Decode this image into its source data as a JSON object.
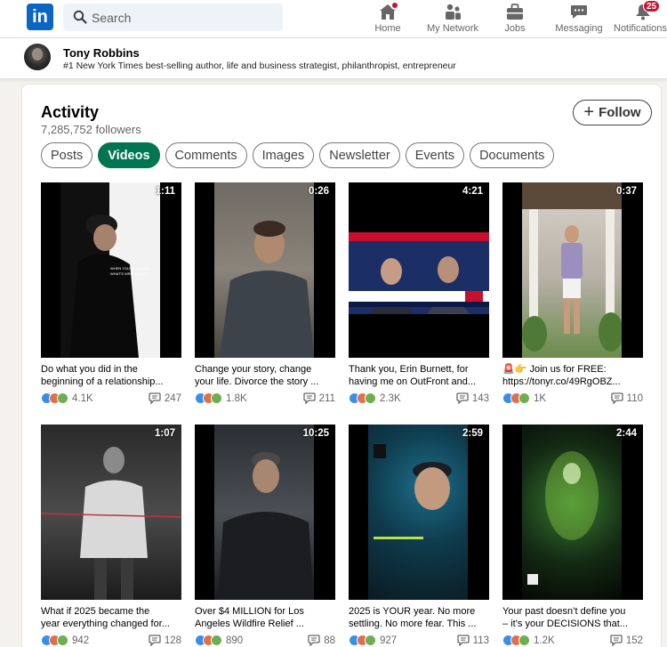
{
  "nav": {
    "logo_text": "in",
    "search_placeholder": "Search",
    "items": [
      {
        "label": "Home",
        "icon": "home-icon"
      },
      {
        "label": "My Network",
        "icon": "network-icon"
      },
      {
        "label": "Jobs",
        "icon": "briefcase-icon"
      },
      {
        "label": "Messaging",
        "icon": "message-icon"
      },
      {
        "label": "Notifications",
        "icon": "bell-icon",
        "badge": "25"
      }
    ]
  },
  "profile": {
    "name": "Tony Robbins",
    "tagline": "#1 New York Times best-selling author, life and business strategist, philanthropist, entrepreneur"
  },
  "activity": {
    "title": "Activity",
    "followers": "7,285,752 followers",
    "follow_label": "Follow",
    "tabs": [
      "Posts",
      "Videos",
      "Comments",
      "Images",
      "Newsletter",
      "Events",
      "Documents"
    ],
    "active_tab": "Videos"
  },
  "videos": [
    {
      "duration": "1:11",
      "caption_line1": "Do what you did in the",
      "caption_line2": "beginning of a relationship...",
      "reactions": "4.1K",
      "comments": "247"
    },
    {
      "duration": "0:26",
      "caption_line1": "Change your story, change",
      "caption_line2": "your life. Divorce the story ...",
      "reactions": "1.8K",
      "comments": "211"
    },
    {
      "duration": "4:21",
      "caption_line1": "Thank you, Erin Burnett, for",
      "caption_line2": "having me on OutFront and...",
      "reactions": "2.3K",
      "comments": "143"
    },
    {
      "duration": "0:37",
      "caption_line1": "Join us for FREE:",
      "caption_line2": "https://tonyr.co/49RgOBZ...",
      "reactions": "1K",
      "comments": "110"
    },
    {
      "duration": "1:07",
      "caption_line1": "What if 2025 became the",
      "caption_line2": "year everything changed for...",
      "reactions": "942",
      "comments": "128"
    },
    {
      "duration": "10:25",
      "caption_line1": "Over $4 MILLION for Los",
      "caption_line2": "Angeles Wildfire Relief ...",
      "reactions": "890",
      "comments": "88"
    },
    {
      "duration": "2:59",
      "caption_line1": "2025 is YOUR year. No more",
      "caption_line2": "settling. No more fear. This ...",
      "reactions": "927",
      "comments": "113"
    },
    {
      "duration": "2:44",
      "caption_line1": "Your past doesn’t define you",
      "caption_line2": "– it’s your DECISIONS that...",
      "reactions": "1.2K",
      "comments": "152"
    }
  ],
  "colors": {
    "brand": "#0a66c2",
    "active_tab": "#01754f",
    "notification": "#cb112d"
  }
}
